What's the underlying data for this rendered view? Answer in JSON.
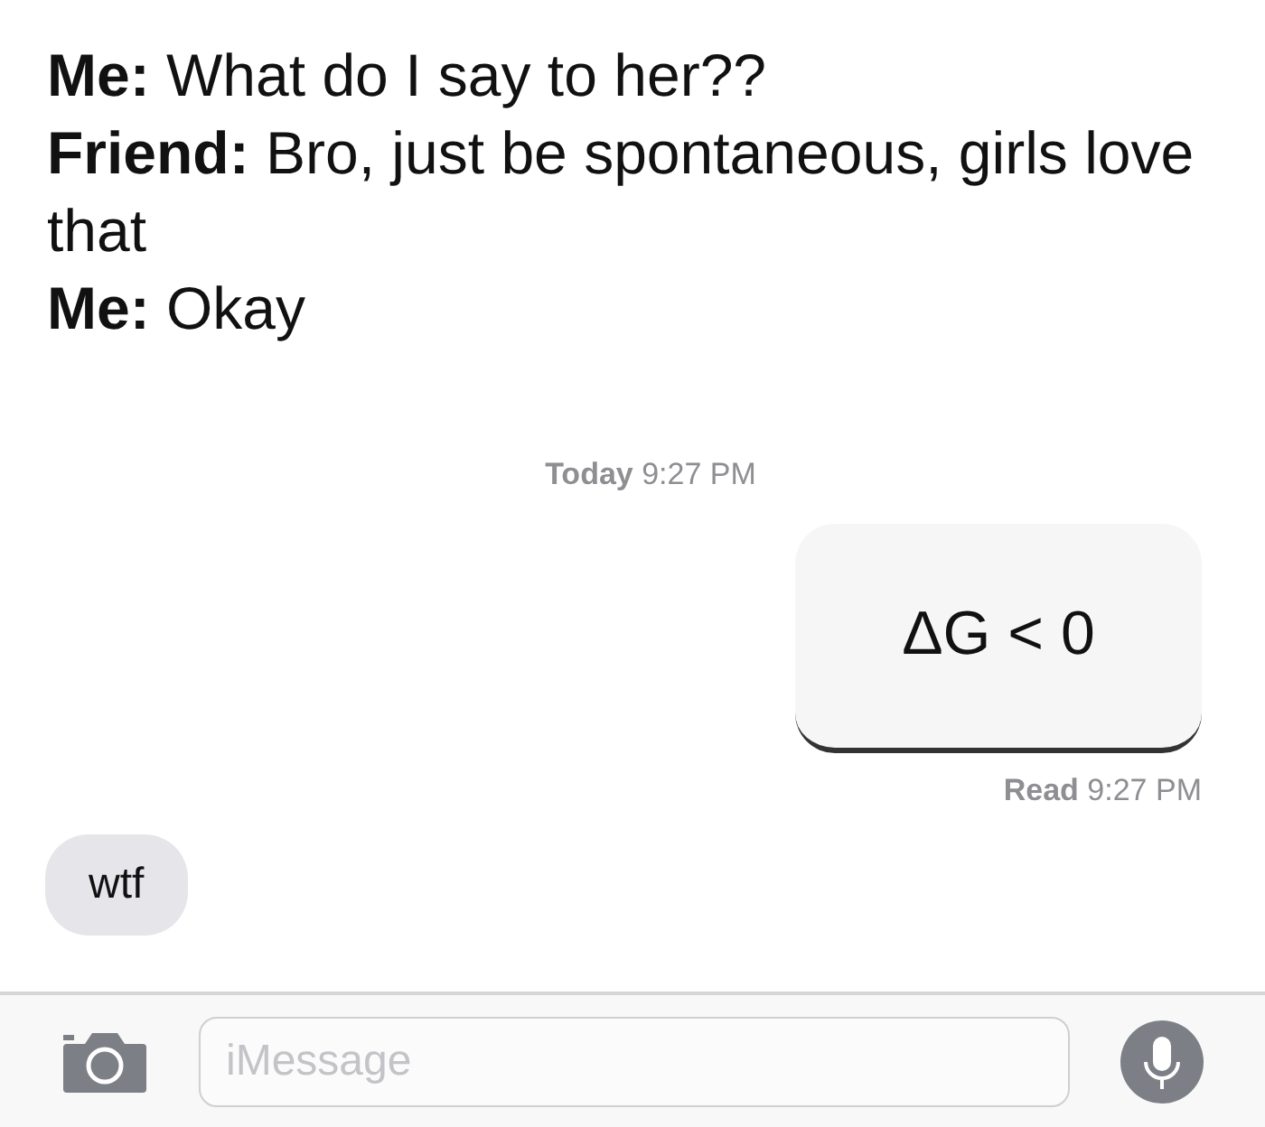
{
  "caption": [
    "**Me:** What do I say to her??",
    "**Friend:** Bro, just be spontaneous, girls love that",
    "**Me:** Okay"
  ],
  "timestamp": "**Today** 9:27 PM",
  "messages": [
    {
      "kind": "sent",
      "text": "ΔG < 0",
      "receipt": "**Read** 9:27 PM"
    },
    {
      "kind": "received",
      "text": "wtf"
    }
  ],
  "composer": {
    "placeholder": "iMessage"
  }
}
